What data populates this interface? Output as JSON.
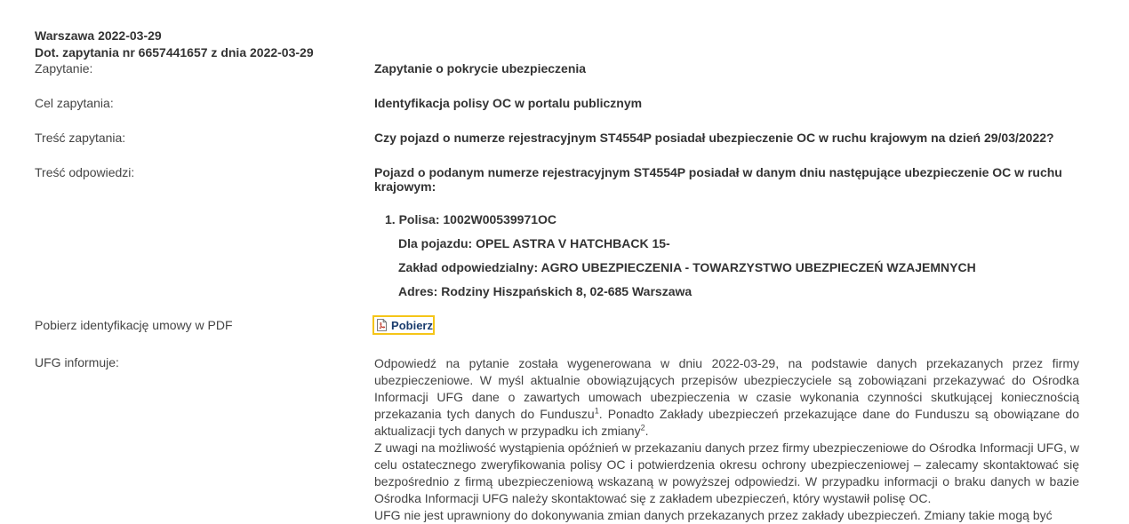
{
  "header": {
    "place_date": "Warszawa 2022-03-29",
    "reference": "Dot. zapytania nr 6657441657 z dnia 2022-03-29"
  },
  "rows": {
    "zapytanie": {
      "label": "Zapytanie:",
      "value": "Zapytanie o pokrycie ubezpieczenia"
    },
    "cel": {
      "label": "Cel zapytania:",
      "value": "Identyfikacja polisy OC w portalu publicznym"
    },
    "tresc_zap": {
      "label": "Treść zapytania:",
      "value": "Czy pojazd o numerze rejestracyjnym ST4554P posiadał ubezpieczenie OC w ruchu krajowym na dzień 29/03/2022?"
    },
    "tresc_odp": {
      "label": "Treść odpowiedzi:",
      "value": "Pojazd o podanym numerze rejestracyjnym ST4554P posiadał w danym dniu następujące ubezpieczenie OC w ruchu krajowym:"
    }
  },
  "policy": {
    "polisa": "Polisa: 1002W00539971OC",
    "pojazd": "Dla pojazdu: OPEL ASTRA V HATCHBACK 15-",
    "zaklad": "Zakład odpowiedzialny: AGRO UBEZPIECZENIA - TOWARZYSTWO UBEZPIECZEŃ WZAJEMNYCH",
    "adres": "Adres: Rodziny Hiszpańskich 8, 02-685 Warszawa"
  },
  "pdf": {
    "label": "Pobierz identyfikację umowy w PDF",
    "button": "Pobierz"
  },
  "ufg": {
    "label": "UFG informuje:",
    "p1a": "Odpowiedź na pytanie została wygenerowana w dniu 2022-03-29, na podstawie danych przekazanych przez firmy ubezpieczeniowe. W myśl aktualnie obowiązujących przepisów ubezpieczyciele są zobowiązani przekazywać do Ośrodka Informacji UFG dane o zawartych umowach ubezpieczenia w czasie wykonania czynności skutkującej koniecznością przekazania tych danych do Funduszu",
    "sup1": "1",
    "p1b": ". Ponadto Zakłady ubezpieczeń przekazujące dane do Funduszu są obowiązane do aktualizacji tych danych w przypadku ich zmiany",
    "sup2": "2",
    "p1c": ".",
    "p2": "Z uwagi na możliwość wystąpienia opóźnień w przekazaniu danych przez firmy ubezpieczeniowe do Ośrodka Informacji UFG, w celu ostatecznego zweryfikowania polisy OC i potwierdzenia okresu ochrony ubezpieczeniowej – zalecamy skontaktować się bezpośrednio z firmą ubezpieczeniową wskazaną w powyższej odpowiedzi. W przypadku informacji o braku danych w bazie Ośrodka Informacji UFG należy skontaktować się z zakładem ubezpieczeń, który wystawił polisę OC.",
    "p3": "UFG nie jest uprawniony do dokonywania zmian danych przekazanych przez zakłady ubezpieczeń. Zmiany takie mogą być"
  }
}
